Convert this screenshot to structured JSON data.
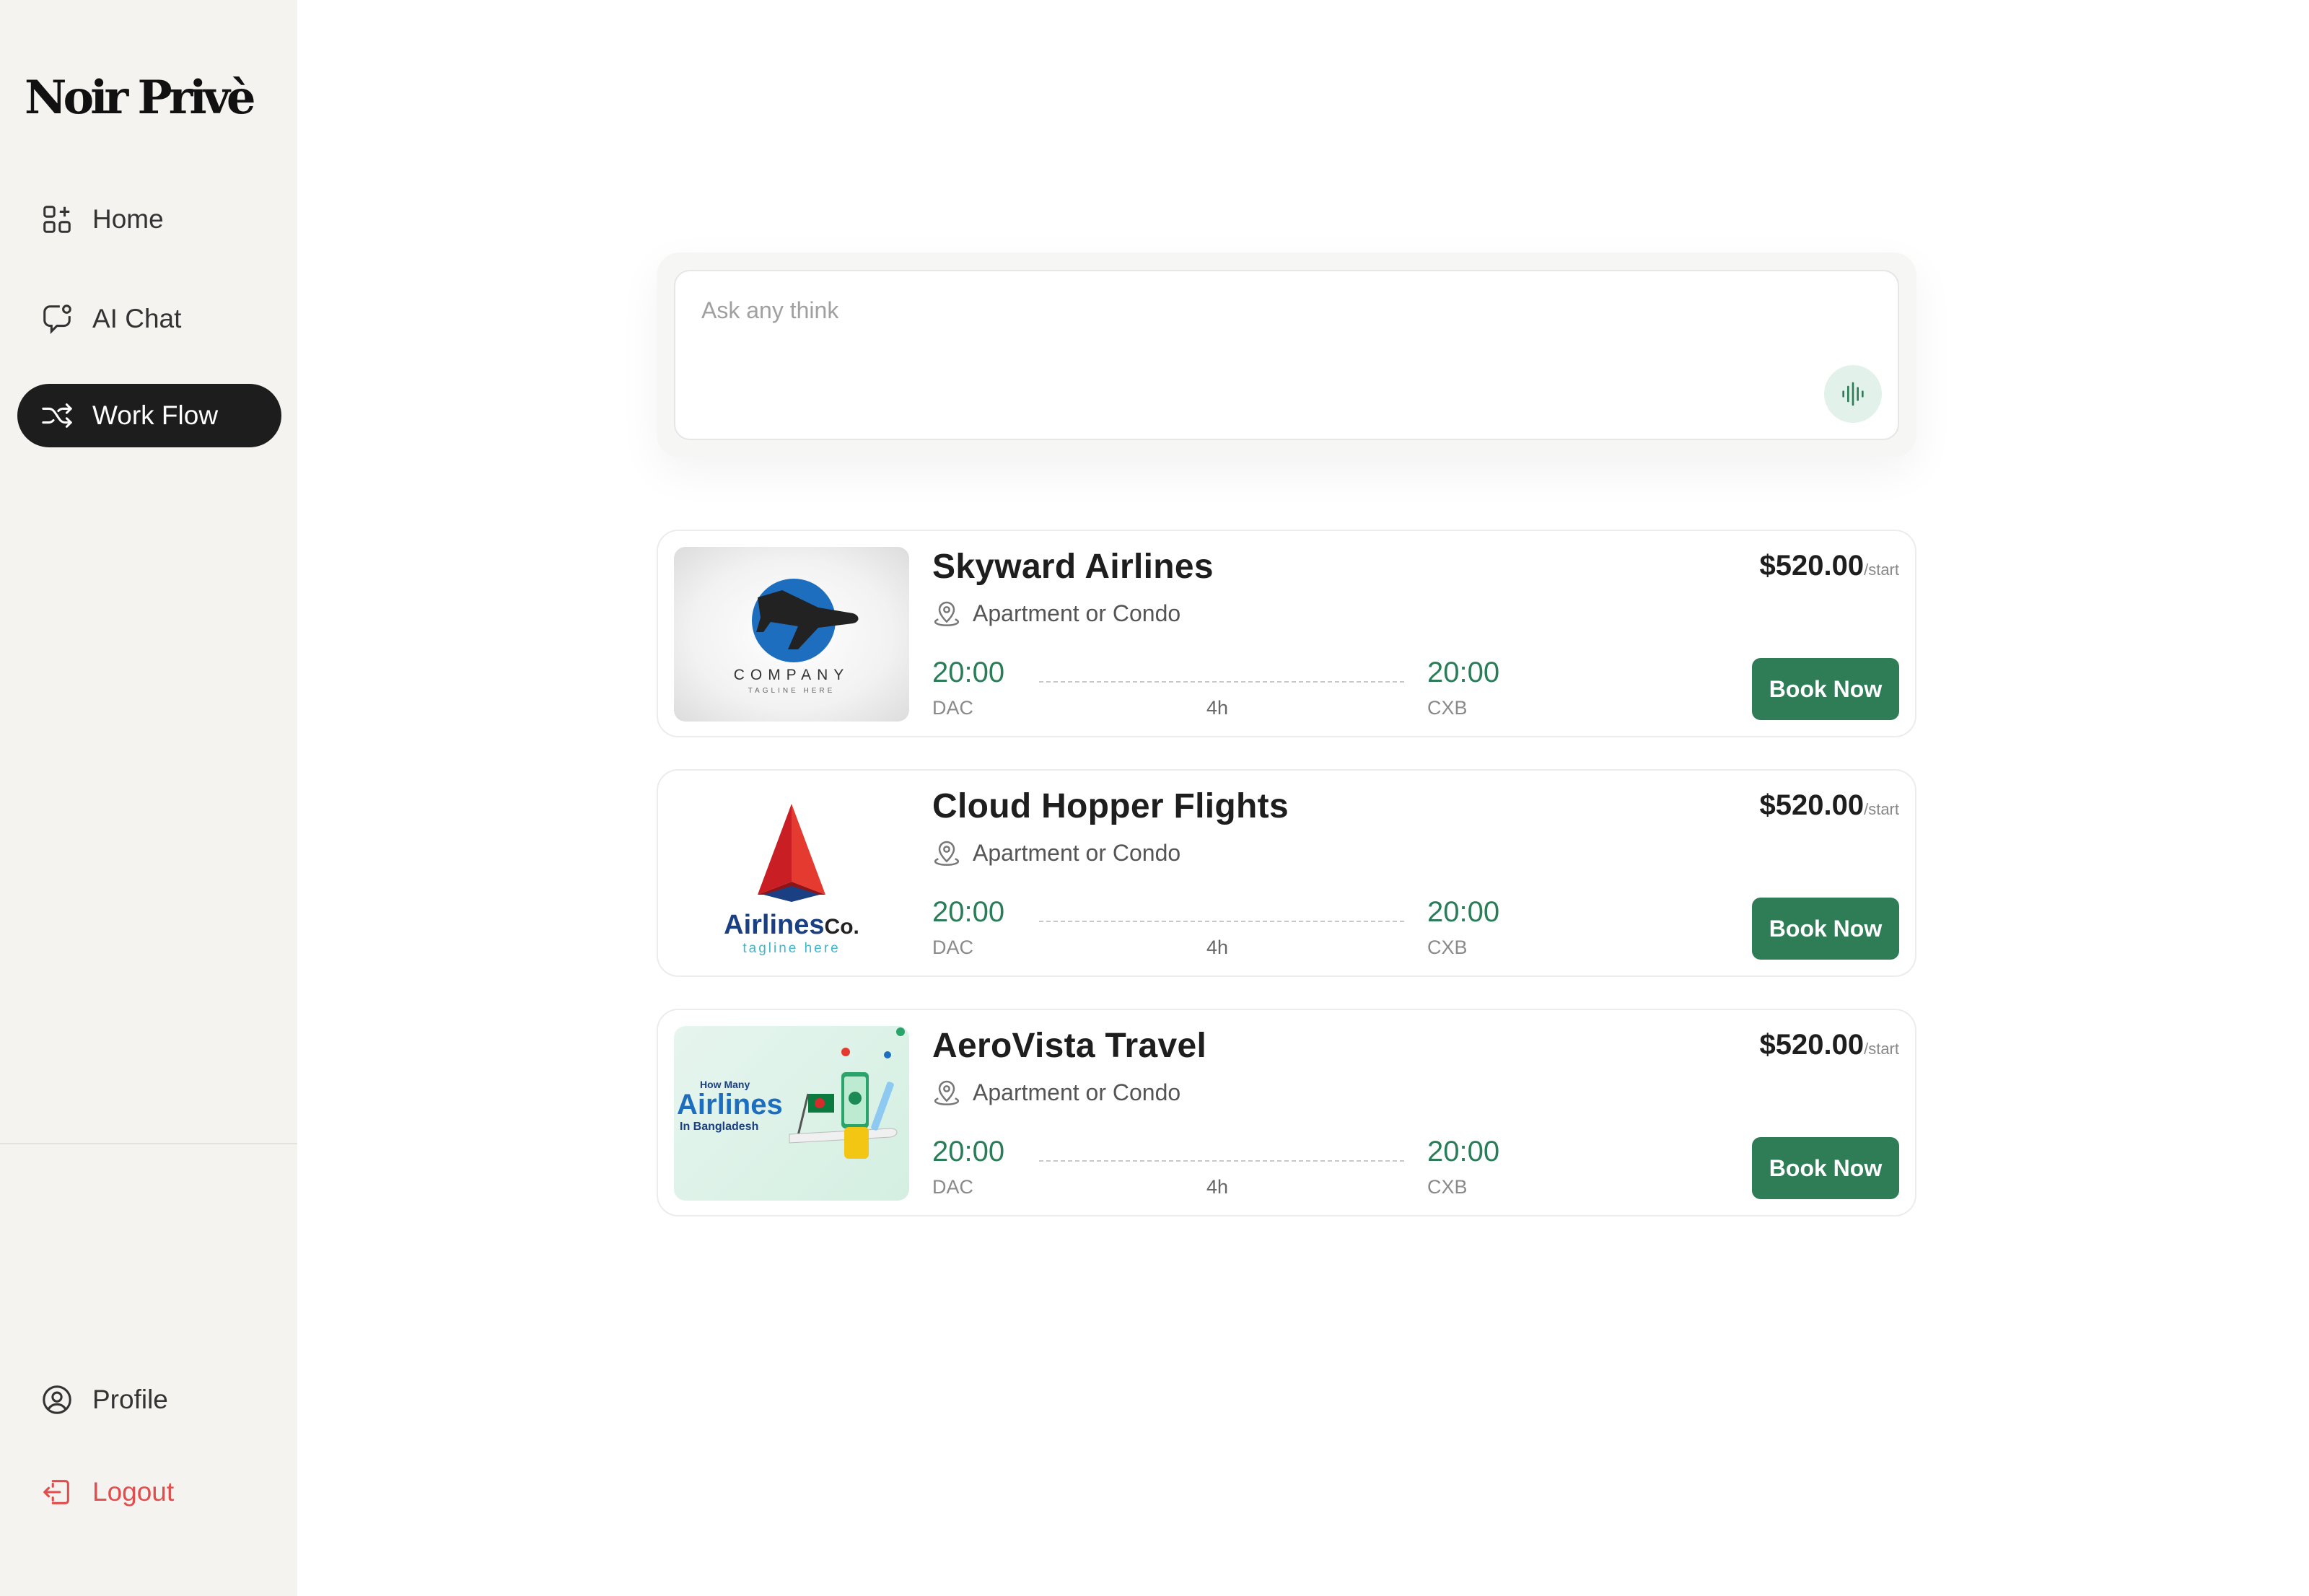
{
  "brand": {
    "logo_text": "Noir Privè"
  },
  "sidebar": {
    "items": [
      {
        "label": "Home",
        "icon": "grid-plus-icon"
      },
      {
        "label": "AI Chat",
        "icon": "chat-bubble-icon"
      },
      {
        "label": "Work Flow",
        "icon": "shuffle-icon",
        "active": true
      }
    ],
    "bottom": [
      {
        "label": "Profile",
        "icon": "user-circle-icon"
      },
      {
        "label": "Logout",
        "icon": "logout-icon"
      }
    ]
  },
  "search": {
    "placeholder": "Ask any think",
    "value": ""
  },
  "cards": [
    {
      "name": "Skyward Airlines",
      "location": "Apartment or Condo",
      "price": "$520.00",
      "price_unit": "/start",
      "depart_time": "20:00",
      "depart_code": "DAC",
      "arrive_time": "20:00",
      "arrive_code": "CXB",
      "duration": "4h",
      "book_label": "Book Now",
      "logo": {
        "line1": "COMPANY",
        "line2": "TAGLINE HERE"
      }
    },
    {
      "name": "Cloud Hopper Flights",
      "location": "Apartment or Condo",
      "price": "$520.00",
      "price_unit": "/start",
      "depart_time": "20:00",
      "depart_code": "DAC",
      "arrive_time": "20:00",
      "arrive_code": "CXB",
      "duration": "4h",
      "book_label": "Book Now",
      "logo": {
        "word_a": "Airlines",
        "word_b": "Co.",
        "tagline": "tagline here"
      }
    },
    {
      "name": "AeroVista Travel",
      "location": "Apartment or Condo",
      "price": "$520.00",
      "price_unit": "/start",
      "depart_time": "20:00",
      "depart_code": "DAC",
      "arrive_time": "20:00",
      "arrive_code": "CXB",
      "duration": "4h",
      "book_label": "Book Now",
      "logo": {
        "small": "How Many",
        "big": "Airlines",
        "sub": "In Bangladesh"
      }
    }
  ],
  "colors": {
    "accent": "#2e7d57",
    "time_green": "#2a7d58",
    "logout_red": "#e24c4c",
    "active_nav": "#1d1d1d",
    "sidebar_bg": "#f4f3ef"
  }
}
